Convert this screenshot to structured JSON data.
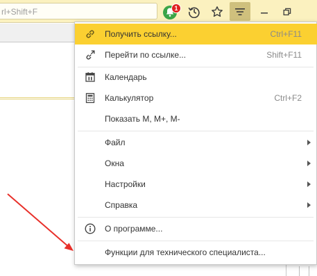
{
  "toolbar": {
    "search_hint": "rl+Shift+F",
    "notification_count": "1",
    "icons": [
      "notifications-icon",
      "history-icon",
      "favorites-star-icon",
      "main-menu-icon",
      "minimize-icon",
      "restore-icon"
    ]
  },
  "menu": {
    "items": [
      {
        "label": "Получить ссылку...",
        "shortcut": "Ctrl+F11",
        "icon": "link-icon",
        "highlighted": true
      },
      {
        "label": "Перейти по ссылке...",
        "shortcut": "Shift+F11",
        "icon": "follow-link-icon"
      },
      {
        "label": "Календарь",
        "shortcut": "",
        "icon": "calendar-icon"
      },
      {
        "label": "Калькулятор",
        "shortcut": "Ctrl+F2",
        "icon": "calculator-icon"
      },
      {
        "label": "Показать M, M+, M-",
        "shortcut": ""
      },
      {
        "label": "Файл",
        "submenu": true
      },
      {
        "label": "Окна",
        "submenu": true
      },
      {
        "label": "Настройки",
        "submenu": true
      },
      {
        "label": "Справка",
        "submenu": true
      },
      {
        "label": "О программе...",
        "icon": "info-icon"
      },
      {
        "label": "Функции для технического специалиста..."
      }
    ]
  },
  "colors": {
    "toolbar_bg": "#fbf1bf",
    "highlight": "#fbd031",
    "badge": "#e02020",
    "bell": "#3aa548",
    "annotation_arrow": "#e8302a"
  }
}
